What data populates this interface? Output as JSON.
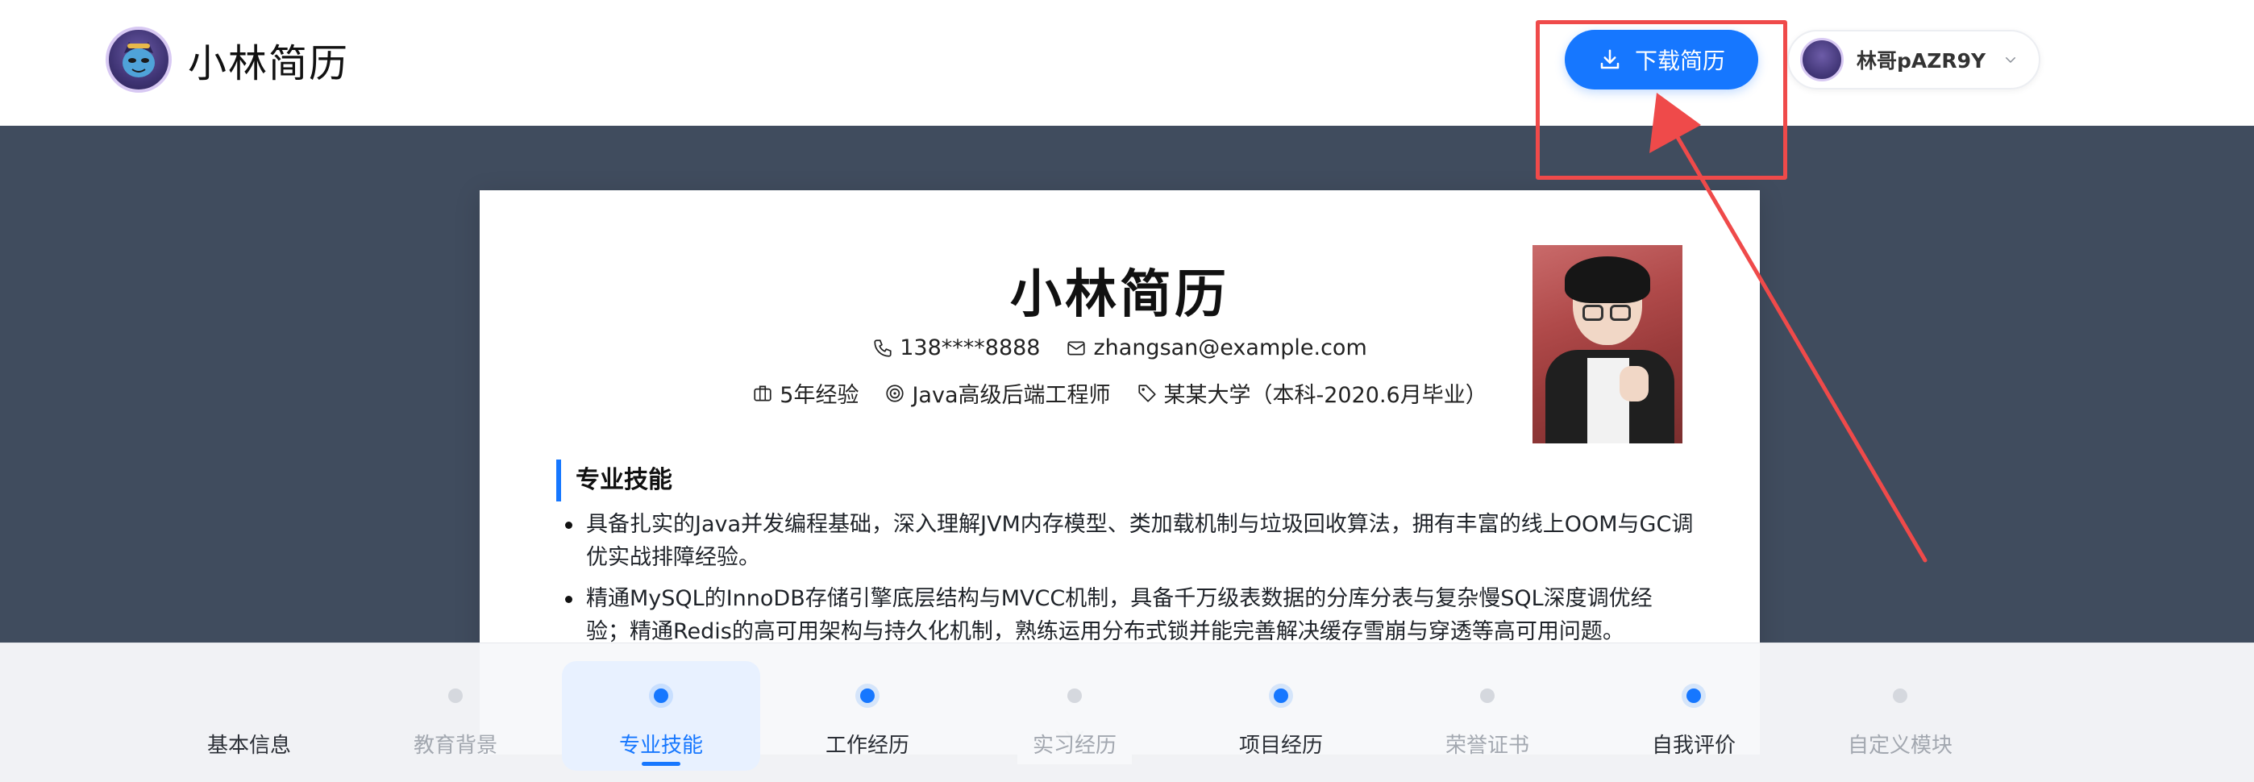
{
  "header": {
    "brand_title": "小林简历",
    "download_label": "下载简历",
    "user_name": "林哥pAZR9Y"
  },
  "resume": {
    "name": "小林简历",
    "phone": "138****8888",
    "email": "zhangsan@example.com",
    "experience": "5年经验",
    "position": "Java高级后端工程师",
    "education": "某某大学（本科-2020.6月毕业）",
    "section_title": "专业技能",
    "skills": [
      "具备扎实的Java并发编程基础，深入理解JVM内存模型、类加载机制与垃圾回收算法，拥有丰富的线上OOM与GC调优实战排障经验。",
      "精通MySQL的InnoDB存储引擎底层结构与MVCC机制，具备千万级表数据的分库分表与复杂慢SQL深度调优经验；精通Redis的高可用架构与持久化机制，熟练运用分布式锁并能完善解决缓存雪崩与穿透等高可用问题。"
    ]
  },
  "bottom_nav": [
    {
      "label": "基本信息",
      "state": "filled",
      "dot": "none"
    },
    {
      "label": "教育背景",
      "state": "empty",
      "dot": "grey"
    },
    {
      "label": "专业技能",
      "state": "active",
      "dot": "blue"
    },
    {
      "label": "工作经历",
      "state": "filled",
      "dot": "blue"
    },
    {
      "label": "实习经历",
      "state": "empty",
      "dot": "grey"
    },
    {
      "label": "项目经历",
      "state": "filled",
      "dot": "blue"
    },
    {
      "label": "荣誉证书",
      "state": "empty",
      "dot": "grey"
    },
    {
      "label": "自我评价",
      "state": "filled",
      "dot": "blue"
    },
    {
      "label": "自定义模块",
      "state": "empty",
      "dot": "grey"
    }
  ],
  "colors": {
    "accent": "#1677ff",
    "workspace_bg": "#404c5e",
    "annotation": "#ef4a4a"
  },
  "icons": {
    "download": "download-icon",
    "phone": "phone-icon",
    "email": "mail-icon",
    "experience": "briefcase-icon",
    "position": "target-icon",
    "education": "tag-icon",
    "collapse": "chevron-down-icon"
  }
}
